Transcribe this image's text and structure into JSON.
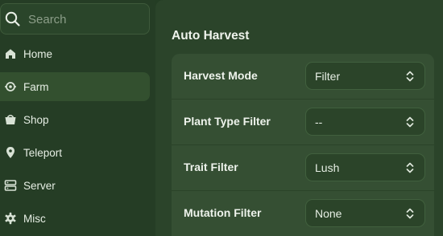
{
  "search": {
    "placeholder": "Search"
  },
  "sidebar": {
    "items": [
      {
        "label": "Home",
        "icon": "home-icon",
        "active": false
      },
      {
        "label": "Farm",
        "icon": "farm-icon",
        "active": true
      },
      {
        "label": "Shop",
        "icon": "shop-icon",
        "active": false
      },
      {
        "label": "Teleport",
        "icon": "location-pin-icon",
        "active": false
      },
      {
        "label": "Server",
        "icon": "server-icon",
        "active": false
      },
      {
        "label": "Misc",
        "icon": "gear-icon",
        "active": false
      }
    ]
  },
  "main": {
    "section_title": "Auto Harvest",
    "settings": [
      {
        "label": "Harvest Mode",
        "value": "Filter"
      },
      {
        "label": "Plant Type Filter",
        "value": "--"
      },
      {
        "label": "Trait Filter",
        "value": "Lush"
      },
      {
        "label": "Mutation Filter",
        "value": "None"
      }
    ]
  },
  "colors": {
    "background": "#243d24",
    "panel": "#2b442a",
    "card": "#354f33",
    "active_item": "#33502f",
    "text": "#e8efe6"
  }
}
